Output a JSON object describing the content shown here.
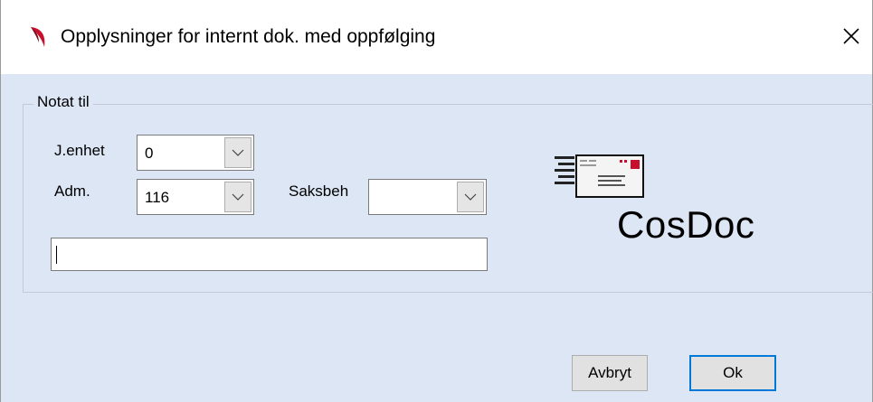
{
  "window": {
    "title": "Opplysninger for internt dok. med oppfølging",
    "close_glyph": "✕"
  },
  "group": {
    "legend": "Notat til"
  },
  "form": {
    "jenhet": {
      "label": "J.enhet",
      "value": "0"
    },
    "adm": {
      "label": "Adm.",
      "value": "116"
    },
    "saksbeh": {
      "label": "Saksbeh",
      "value": ""
    },
    "note_text": ""
  },
  "logo": {
    "text": "CosDoc",
    "icon": "envelope-speed-icon"
  },
  "buttons": {
    "cancel_label": "Avbryt",
    "ok_label": "Ok"
  },
  "colors": {
    "client_background": "#dde6f5",
    "ok_border": "#0078d7",
    "app_icon_red": "#c8102e"
  }
}
